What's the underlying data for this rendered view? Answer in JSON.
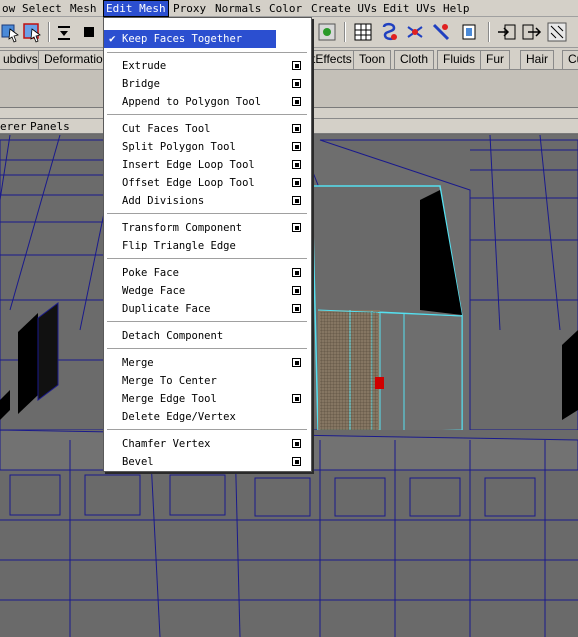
{
  "menubar": {
    "items": [
      {
        "label": "ow"
      },
      {
        "label": "Select"
      },
      {
        "label": "Mesh"
      },
      {
        "label": "Edit Mesh"
      },
      {
        "label": "Proxy"
      },
      {
        "label": "Normals"
      },
      {
        "label": "Color"
      },
      {
        "label": "Create UVs"
      },
      {
        "label": "Edit UVs"
      },
      {
        "label": "Help"
      }
    ],
    "open_item": "Edit Mesh"
  },
  "shelf": {
    "tabs": [
      "ubdivs",
      "Deformation",
      "tEffects",
      "Toon",
      "Cloth",
      "Fluids",
      "Fur",
      "Hair",
      "Cu"
    ]
  },
  "panel_menu": {
    "items": [
      "erer",
      "Panels"
    ]
  },
  "edit_mesh_menu": {
    "keep_faces_together": {
      "label": "Keep Faces Together",
      "checked": true,
      "check_glyph": "✔"
    },
    "items": [
      {
        "label": "Extrude",
        "has_option": true
      },
      {
        "label": "Bridge",
        "has_option": true
      },
      {
        "label": "Append to Polygon Tool",
        "has_option": true
      },
      {
        "label": "Cut Faces Tool",
        "has_option": true
      },
      {
        "label": "Split Polygon Tool",
        "has_option": true
      },
      {
        "label": "Insert Edge Loop Tool",
        "has_option": true
      },
      {
        "label": "Offset Edge Loop Tool",
        "has_option": true
      },
      {
        "label": "Add Divisions",
        "has_option": true
      },
      {
        "label": "Transform Component",
        "has_option": true
      },
      {
        "label": "Flip Triangle Edge",
        "has_option": false
      },
      {
        "label": "Poke Face",
        "has_option": true
      },
      {
        "label": "Wedge Face",
        "has_option": true
      },
      {
        "label": "Duplicate Face",
        "has_option": true
      },
      {
        "label": "Detach Component",
        "has_option": false
      },
      {
        "label": "Merge",
        "has_option": true
      },
      {
        "label": "Merge To Center",
        "has_option": false
      },
      {
        "label": "Merge Edge Tool",
        "has_option": true
      },
      {
        "label": "Delete Edge/Vertex",
        "has_option": false
      },
      {
        "label": "Chamfer Vertex",
        "has_option": true
      },
      {
        "label": "Bevel",
        "has_option": true
      }
    ]
  },
  "colors": {
    "ui_gray": "#d4d0c8",
    "highlight": "#2b4fd0",
    "viewport": "#6e6e6e",
    "wire": "#1a1a8c",
    "selection": "#55e0f0",
    "component": "#d00000"
  },
  "toolbar_icons": [
    "select-tool-icon",
    "lasso-icon",
    "menu-set-icon",
    "snap-grid-icon",
    "snap-curve-icon",
    "snap-point-icon",
    "snap-plane-icon",
    "make-live-icon",
    "history-icon",
    "render-icon",
    "ipr-render-icon",
    "render-settings-icon",
    "input-output-icon",
    "toggle-panel-icon"
  ]
}
